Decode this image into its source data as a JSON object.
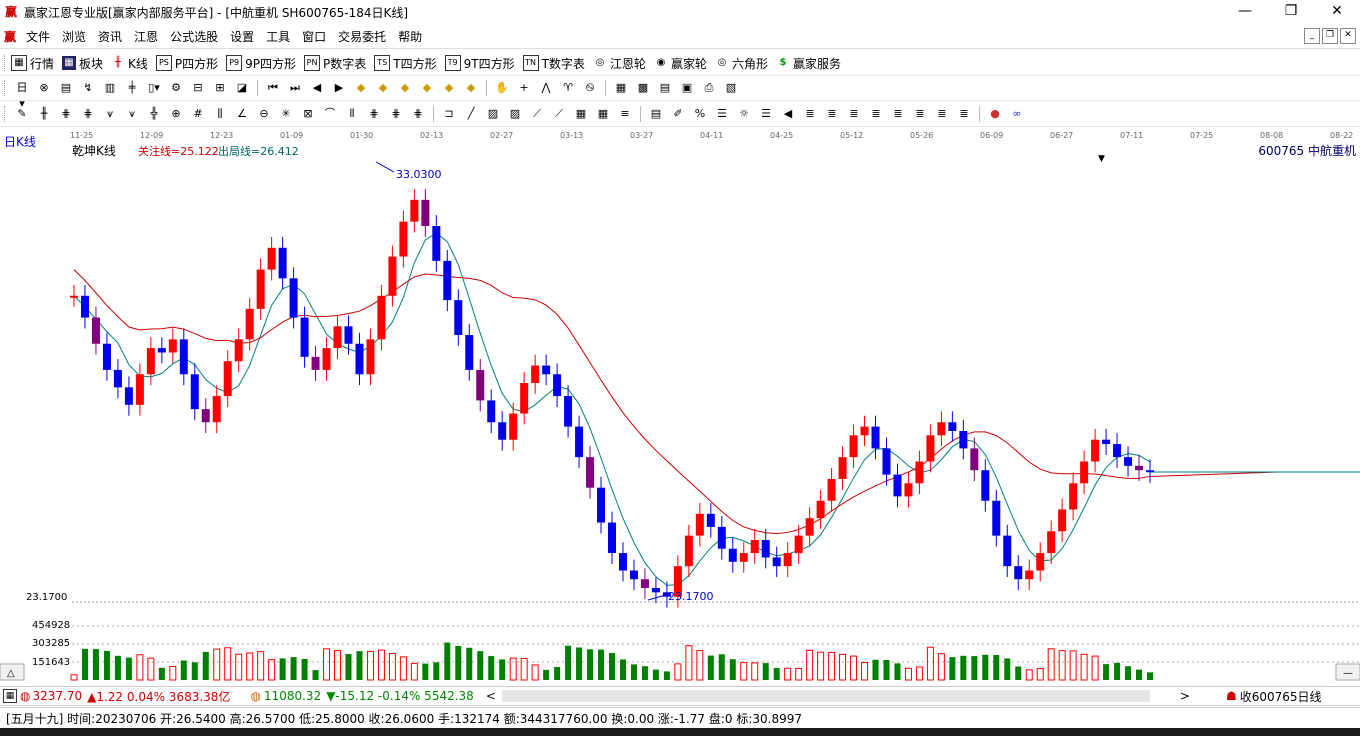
{
  "window": {
    "title": "赢家江恩专业版[赢家内部服务平台] - [中航重机  SH600765-184日K线]",
    "app_icon": "赢",
    "controls": [
      "—",
      "❐",
      "✕"
    ]
  },
  "menu": {
    "items": [
      "文件",
      "浏览",
      "资讯",
      "江恩",
      "公式选股",
      "设置",
      "工具",
      "窗口",
      "交易委托",
      "帮助"
    ]
  },
  "toolbar1": {
    "items": [
      {
        "icon": "table-icon",
        "label": "行情"
      },
      {
        "icon": "grid-icon",
        "label": "板块"
      },
      {
        "icon": "candle-icon",
        "label": "K线"
      },
      {
        "icon": "ps-icon",
        "label": "P四方形"
      },
      {
        "icon": "p9-icon",
        "label": "9P四方形"
      },
      {
        "icon": "pn-icon",
        "label": "P数字表"
      },
      {
        "icon": "ts-icon",
        "label": "T四方形"
      },
      {
        "icon": "t9-icon",
        "label": "9T四方形"
      },
      {
        "icon": "tn-icon",
        "label": "T数字表"
      },
      {
        "icon": "wheel-icon",
        "label": "江恩轮"
      },
      {
        "icon": "wheel2-icon",
        "label": "赢家轮"
      },
      {
        "icon": "hexagon-icon",
        "label": "六角形"
      },
      {
        "icon": "dollar-icon",
        "label": "赢家服务"
      }
    ]
  },
  "chart": {
    "period_label": "日K线",
    "indicator_name": "乾坤K线",
    "focus_line": "关注线=25.122",
    "exit_line": "出局线=26.412",
    "stock_label": "600765  中航重机",
    "high_label": "33.0300",
    "low_label": "23.1700",
    "axis_price_label": "23.1700",
    "volume_labels": [
      "454928",
      "303285",
      "151643"
    ],
    "date_ticks": [
      "11-25",
      "12-09",
      "12-23",
      "01-09",
      "01-30",
      "02-13",
      "02-27",
      "03-13",
      "03-27",
      "04-11",
      "04-25",
      "05-12",
      "05-26",
      "06-09",
      "06-27",
      "07-11",
      "07-25",
      "08-08",
      "08-22"
    ],
    "colors": {
      "up": "#ff0000",
      "down": "#0000ee",
      "mid": "#800080",
      "ma_short": "#008080",
      "ma_long": "#cc0000",
      "volume_up": "#ff0000",
      "volume_down": "#008000"
    }
  },
  "chart_data": {
    "type": "candlestick",
    "title": "",
    "x_ticks": [
      "11-25",
      "12-09",
      "12-23",
      "01-09",
      "01-30",
      "02-13",
      "02-27",
      "03-13",
      "03-27",
      "04-11",
      "04-25",
      "05-12",
      "05-26",
      "06-09",
      "06-27",
      "07-11"
    ],
    "ylim": [
      23.17,
      33.03
    ],
    "close_points": [
      30.1,
      29.6,
      29.0,
      28.4,
      28.0,
      27.6,
      28.3,
      28.9,
      28.8,
      29.1,
      28.3,
      27.5,
      27.2,
      27.8,
      28.6,
      29.1,
      29.8,
      30.7,
      31.2,
      30.5,
      29.6,
      28.7,
      28.4,
      28.9,
      29.4,
      29.0,
      28.3,
      29.1,
      30.1,
      31.0,
      31.8,
      32.3,
      31.7,
      30.9,
      30.0,
      29.2,
      28.4,
      27.7,
      27.2,
      26.8,
      27.4,
      28.1,
      28.5,
      28.3,
      27.8,
      27.1,
      26.4,
      25.7,
      24.9,
      24.2,
      23.8,
      23.6,
      23.4,
      23.3,
      23.2,
      23.9,
      24.6,
      25.1,
      24.8,
      24.3,
      24.0,
      24.2,
      24.5,
      24.1,
      23.9,
      24.2,
      24.6,
      25.0,
      25.4,
      25.9,
      26.4,
      26.9,
      27.1,
      26.6,
      26.0,
      25.5,
      25.8,
      26.3,
      26.9,
      27.2,
      27.0,
      26.6,
      26.1,
      25.4,
      24.6,
      23.9,
      23.6,
      23.8,
      24.2,
      24.7,
      25.2,
      25.8,
      26.3,
      26.8,
      26.7,
      26.4,
      26.2,
      26.1,
      26.06
    ],
    "annotations": {
      "high": 33.03,
      "low": 23.17
    },
    "volume_ticks": [
      151643,
      303285,
      454928
    ]
  },
  "scroll": {
    "sh_index": "3237.70",
    "sh_change": "▲1.22 0.04% 3683.38亿",
    "sz_index": "11080.32",
    "sz_change": "▼-15.12 -0.14% 5542.38",
    "left_arrow": "<",
    "right_arrow": ">",
    "fav": "收600765日线"
  },
  "status": {
    "text": "[五月十九] 时间:20230706 开:26.5400 高:26.5700 低:25.8000 收:26.0600 手:132174 额:344317760.00 换:0.00 涨:-1.77 盘:0 标:30.8997"
  }
}
